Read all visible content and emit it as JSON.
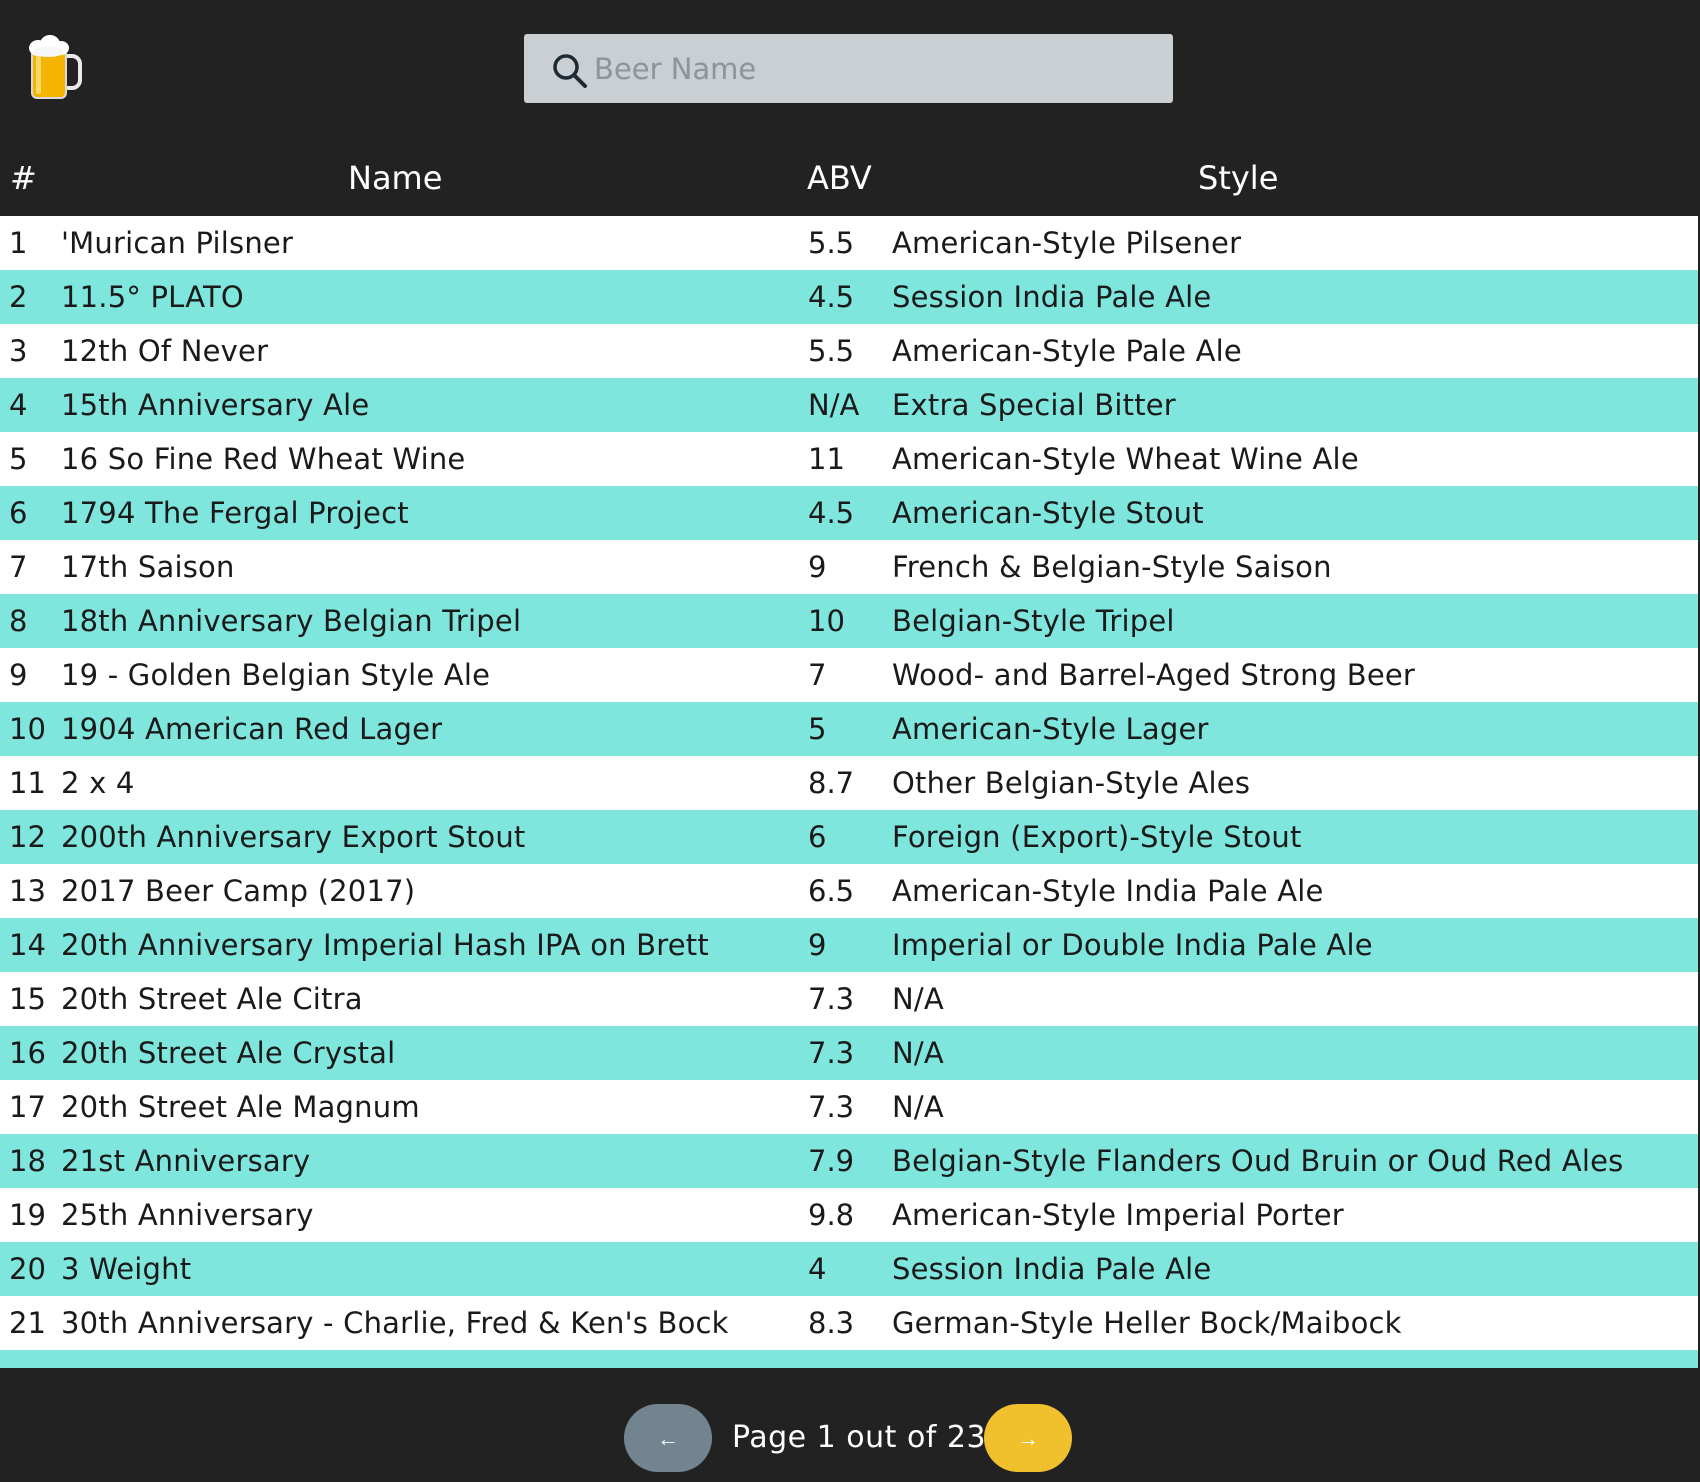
{
  "search": {
    "placeholder": "Beer Name"
  },
  "table": {
    "columns": {
      "num": "#",
      "name": "Name",
      "abv": "ABV",
      "style": "Style"
    },
    "rows": [
      {
        "num": "1",
        "name": "'Murican Pilsner",
        "abv": "5.5",
        "style": "American-Style Pilsener"
      },
      {
        "num": "2",
        "name": "11.5° PLATO",
        "abv": "4.5",
        "style": "Session India Pale Ale"
      },
      {
        "num": "3",
        "name": "12th Of Never",
        "abv": "5.5",
        "style": "American-Style Pale Ale"
      },
      {
        "num": "4",
        "name": "15th Anniversary Ale",
        "abv": "N/A",
        "style": "Extra Special Bitter"
      },
      {
        "num": "5",
        "name": "16 So Fine Red Wheat Wine",
        "abv": "11",
        "style": "American-Style Wheat Wine Ale"
      },
      {
        "num": "6",
        "name": "1794 The Fergal Project",
        "abv": "4.5",
        "style": "American-Style Stout"
      },
      {
        "num": "7",
        "name": "17th Saison",
        "abv": "9",
        "style": "French & Belgian-Style Saison"
      },
      {
        "num": "8",
        "name": "18th Anniversary Belgian Tripel",
        "abv": "10",
        "style": "Belgian-Style Tripel"
      },
      {
        "num": "9",
        "name": "19 - Golden Belgian Style Ale",
        "abv": "7",
        "style": "Wood- and Barrel-Aged Strong Beer"
      },
      {
        "num": "10",
        "name": "1904 American Red Lager",
        "abv": "5",
        "style": "American-Style Lager"
      },
      {
        "num": "11",
        "name": "2 x 4",
        "abv": "8.7",
        "style": "Other Belgian-Style Ales"
      },
      {
        "num": "12",
        "name": "200th Anniversary Export Stout",
        "abv": "6",
        "style": "Foreign (Export)-Style Stout"
      },
      {
        "num": "13",
        "name": "2017 Beer Camp (2017)",
        "abv": "6.5",
        "style": "American-Style India Pale Ale"
      },
      {
        "num": "14",
        "name": "20th Anniversary Imperial Hash IPA on Brett",
        "abv": "9",
        "style": "Imperial or Double India Pale Ale"
      },
      {
        "num": "15",
        "name": "20th Street Ale Citra",
        "abv": "7.3",
        "style": "N/A"
      },
      {
        "num": "16",
        "name": "20th Street Ale Crystal",
        "abv": "7.3",
        "style": "N/A"
      },
      {
        "num": "17",
        "name": "20th Street Ale Magnum",
        "abv": "7.3",
        "style": "N/A"
      },
      {
        "num": "18",
        "name": "21st Anniversary",
        "abv": "7.9",
        "style": "Belgian-Style Flanders Oud Bruin or Oud Red Ales"
      },
      {
        "num": "19",
        "name": "25th Anniversary",
        "abv": "9.8",
        "style": "American-Style Imperial Porter"
      },
      {
        "num": "20",
        "name": "3 Weight",
        "abv": "4",
        "style": "Session India Pale Ale"
      },
      {
        "num": "21",
        "name": "30th Anniversary - Charlie, Fred & Ken's Bock",
        "abv": "8.3",
        "style": "German-Style Heller Bock/Maibock"
      }
    ]
  },
  "pagination": {
    "prev_label": "←",
    "next_label": "→",
    "page_text": "Page 1 out of 23"
  },
  "colors": {
    "background": "#222222",
    "row_alt": "#7ee6dd",
    "row": "#ffffff",
    "search_bg": "#c9cfd2",
    "prev_button": "#738491",
    "next_button": "#f0c02d"
  },
  "icons": {
    "logo": "beer-mug-icon",
    "search": "search-icon"
  }
}
